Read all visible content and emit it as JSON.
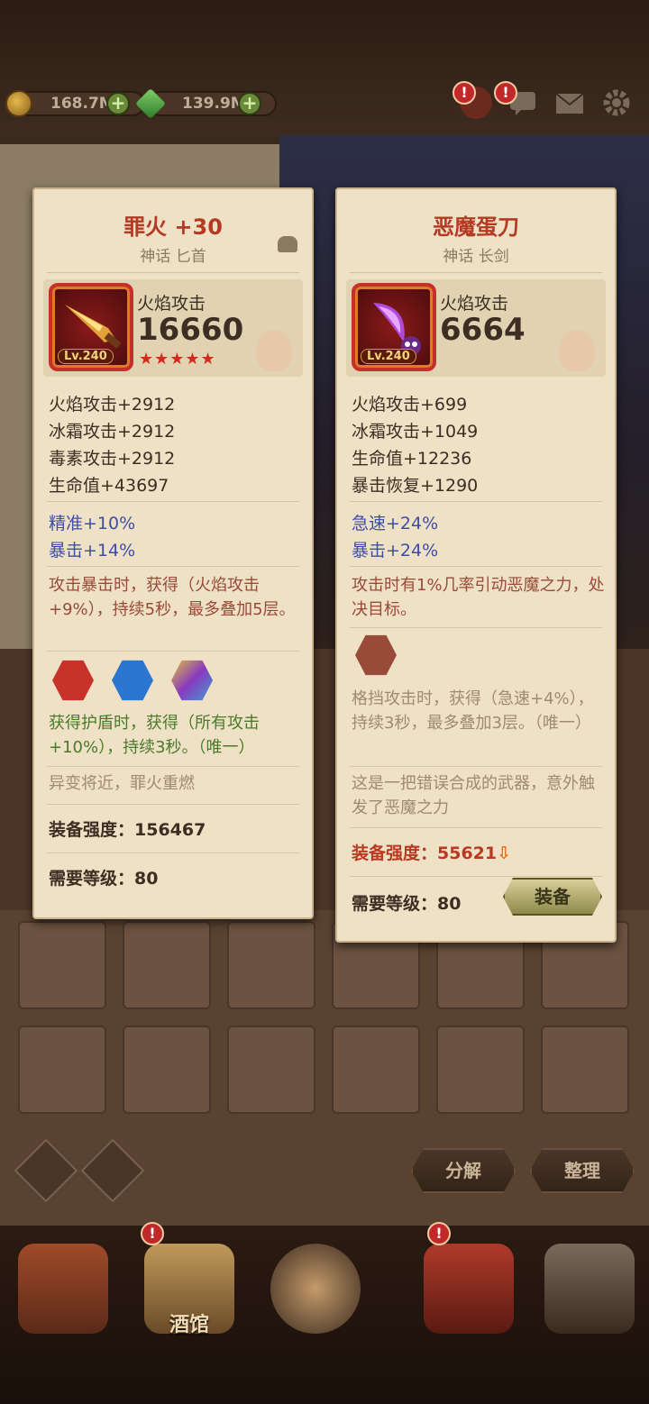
{
  "currency": {
    "gold": "168.7M",
    "gems": "139.9M",
    "plus": "+"
  },
  "alert_mark": "!",
  "left_card": {
    "title": "罪火 +30",
    "subtitle": "神话 匕首",
    "level": "Lv.240",
    "atk_label": "火焰攻击",
    "atk_value": "16660",
    "stars": "★★★★★",
    "stats": [
      "火焰攻击+2912",
      "冰霜攻击+2912",
      "毒素攻击+2912",
      "生命值+43697"
    ],
    "bonus": [
      "精准+10%",
      "暴击+14%"
    ],
    "effect": "攻击暴击时，获得（火焰攻击+9%），持续5秒，最多叠加5层。",
    "rune_effect": "获得护盾时，获得（所有攻击+10%），持续3秒。（唯一）",
    "lore": "异变将近，罪火重燃",
    "power_label": "装备强度：",
    "power_value": "156467",
    "req_label": "需要等级：",
    "req_value": "80"
  },
  "right_card": {
    "title": "恶魔蛋刀",
    "subtitle": "神话 长剑",
    "level": "Lv.240",
    "atk_label": "火焰攻击",
    "atk_value": "6664",
    "stats": [
      "火焰攻击+699",
      "冰霜攻击+1049",
      "生命值+12236",
      "暴击恢复+1290"
    ],
    "bonus": [
      "急速+24%",
      "暴击+24%"
    ],
    "effect": "攻击时有1%几率引动恶魔之力，处决目标。",
    "rune_effect": "格挡攻击时，获得（急速+4%），持续3秒，最多叠加3层。（唯一）",
    "lore": "这是一把错误合成的武器，意外触发了恶魔之力",
    "power_label": "装备强度：",
    "power_value": "55621",
    "power_arrow": "⇩",
    "req_label": "需要等级：",
    "req_value": "80",
    "equip_label": "装备"
  },
  "actions": {
    "decompose": "分解",
    "sort": "整理"
  },
  "nav": {
    "tavern": "酒馆"
  }
}
